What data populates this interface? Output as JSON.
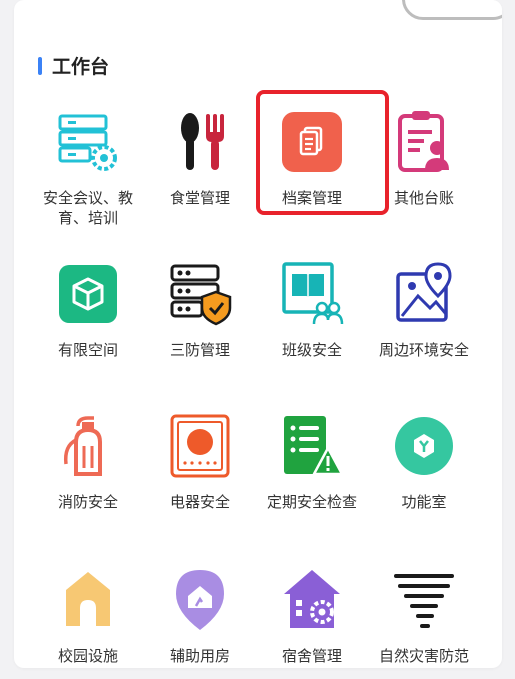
{
  "section": {
    "title": "工作台",
    "accent_color": "#3b82f6"
  },
  "highlight_color": "#e8222b",
  "tiles": [
    {
      "label": "安全会议、教育、培训",
      "icon": "server-gear-icon"
    },
    {
      "label": "食堂管理",
      "icon": "spoon-fork-icon"
    },
    {
      "label": "档案管理",
      "icon": "document-icon"
    },
    {
      "label": "其他台账",
      "icon": "clipboard-person-icon"
    },
    {
      "label": "有限空间",
      "icon": "cube-icon"
    },
    {
      "label": "三防管理",
      "icon": "server-shield-icon"
    },
    {
      "label": "班级安全",
      "icon": "book-people-icon"
    },
    {
      "label": "周边环境安全",
      "icon": "map-pin-icon"
    },
    {
      "label": "消防安全",
      "icon": "fire-extinguisher-icon"
    },
    {
      "label": "电器安全",
      "icon": "oven-icon"
    },
    {
      "label": "定期安全检查",
      "icon": "checklist-warning-icon"
    },
    {
      "label": "功能室",
      "icon": "hexagon-y-icon"
    },
    {
      "label": "校园设施",
      "icon": "arch-gate-icon"
    },
    {
      "label": "辅助用房",
      "icon": "home-pin-icon"
    },
    {
      "label": "宿舍管理",
      "icon": "house-gear-icon"
    },
    {
      "label": "自然灾害防范",
      "icon": "tornado-icon"
    }
  ]
}
